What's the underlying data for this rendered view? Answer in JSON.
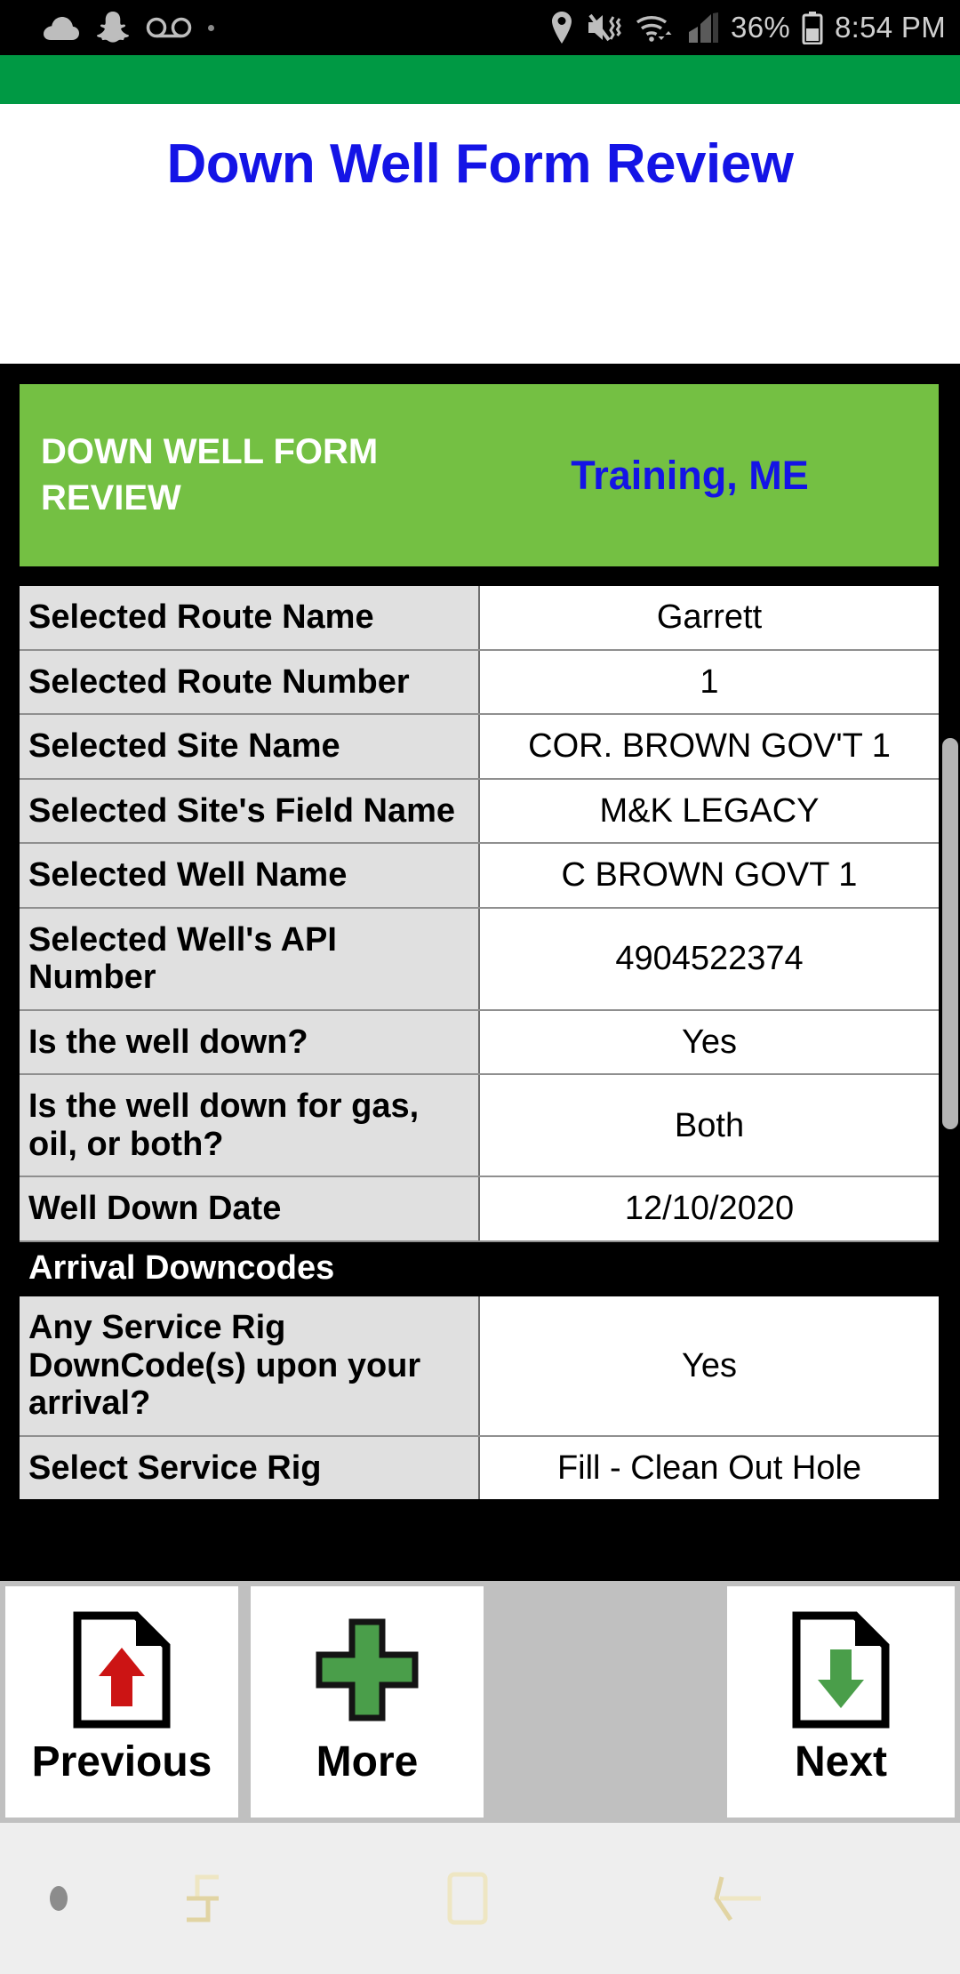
{
  "status_bar": {
    "left_icons": [
      "cloud-icon",
      "snapchat-icon",
      "voicemail-icon",
      "dot-icon"
    ],
    "right_icons": [
      "location-pin-icon",
      "mute-vibrate-icon",
      "wifi-icon",
      "cell-signal-icon",
      "battery-icon"
    ],
    "battery_text": "36%",
    "clock": "8:54 PM"
  },
  "app_bar": {
    "background_color": "#009944"
  },
  "title_area": {
    "page_title": "Down Well Form Review",
    "title_color": "#1414e6"
  },
  "form_header": {
    "title": "DOWN WELL FORM REVIEW",
    "location": "Training, ME",
    "background_color": "#74c043",
    "title_color": "#ffffff",
    "location_color": "#1414e6"
  },
  "table": {
    "rows": [
      {
        "type": "data",
        "label": "Selected Route Name",
        "value": "Garrett"
      },
      {
        "type": "data",
        "label": "Selected Route Number",
        "value": "1"
      },
      {
        "type": "data",
        "label": "Selected Site Name",
        "value": "COR. BROWN GOV'T 1"
      },
      {
        "type": "data",
        "label": "Selected Site's Field Name",
        "value": "M&K LEGACY"
      },
      {
        "type": "data",
        "label": "Selected Well Name",
        "value": "C BROWN GOVT 1"
      },
      {
        "type": "data",
        "label": "Selected Well's API Number",
        "value": "4904522374"
      },
      {
        "type": "data",
        "label": "Is the well down?",
        "value": "Yes"
      },
      {
        "type": "data",
        "label": "Is the well down for gas, oil, or both?",
        "value": "Both"
      },
      {
        "type": "data",
        "label": "Well Down Date",
        "value": "12/10/2020"
      },
      {
        "type": "section",
        "label": "Arrival Downcodes"
      },
      {
        "type": "data",
        "label": "Any Service Rig DownCode(s) upon your arrival?",
        "value": "Yes"
      },
      {
        "type": "data",
        "label": "Select Service Rig",
        "value": "Fill - Clean Out Hole"
      }
    ]
  },
  "toolbar": {
    "previous_label": "Previous",
    "more_label": "More",
    "next_label": "Next",
    "previous_icon": "document-up-arrow-icon",
    "more_icon": "green-plus-icon",
    "next_icon": "document-down-arrow-icon",
    "previous_arrow_color": "#cc1414",
    "next_arrow_color": "#4a9e4a",
    "more_plus_color": "#4a9e4a",
    "background_color": "#c0c0c0"
  },
  "nav_bar": {
    "icons": [
      "dot-icon",
      "recents-icon",
      "home-icon",
      "back-icon"
    ],
    "background_color": "#eeeeee"
  }
}
